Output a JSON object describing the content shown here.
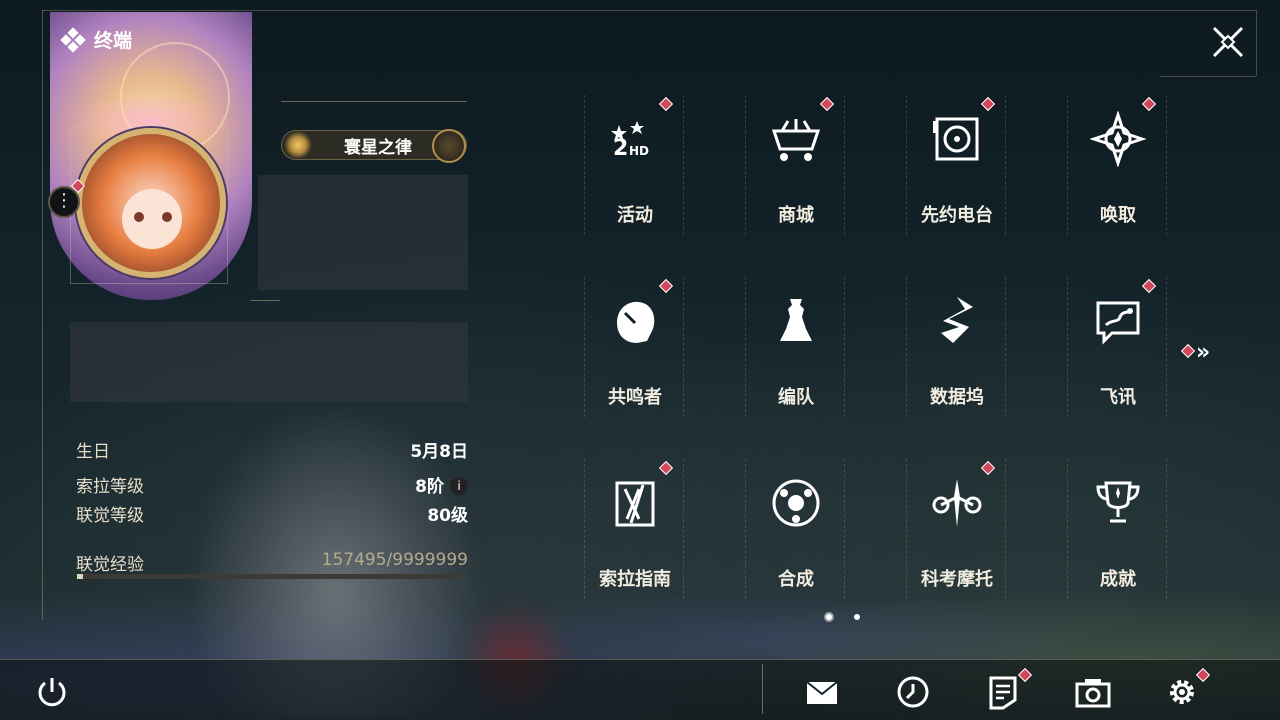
{
  "window": {
    "title": "终端"
  },
  "profile": {
    "name": "寰星之律"
  },
  "stats": [
    {
      "label": "生日",
      "value": "5月8日"
    },
    {
      "label": "索拉等级",
      "value": "8阶"
    },
    {
      "label": "联觉等级",
      "value": "80级"
    }
  ],
  "experience": {
    "label": "联觉经验",
    "value": "157495/9999999",
    "progress_fraction": 0.016
  },
  "menu": [
    {
      "label": "活动",
      "icon": "events-icon",
      "badge": true
    },
    {
      "label": "商城",
      "icon": "shop-cart-icon",
      "badge": true
    },
    {
      "label": "先约电台",
      "icon": "radio-icon",
      "badge": true
    },
    {
      "label": "唤取",
      "icon": "convene-icon",
      "badge": true
    },
    {
      "label": "共鸣者",
      "icon": "resonator-icon",
      "badge": true
    },
    {
      "label": "编队",
      "icon": "team-icon",
      "badge": false
    },
    {
      "label": "数据坞",
      "icon": "data-bank-icon",
      "badge": false
    },
    {
      "label": "飞讯",
      "icon": "messages-icon",
      "badge": true
    },
    {
      "label": "索拉指南",
      "icon": "guidebook-icon",
      "badge": true
    },
    {
      "label": "合成",
      "icon": "synthesis-icon",
      "badge": false
    },
    {
      "label": "科考摩托",
      "icon": "motorbike-icon",
      "badge": true
    },
    {
      "label": "成就",
      "icon": "trophy-icon",
      "badge": false
    }
  ],
  "pagination": {
    "current": 1,
    "total": 2
  },
  "bottom_bar": [
    "power-icon",
    "mail-icon",
    "clock-icon",
    "notice-icon",
    "camera-icon",
    "settings-icon"
  ],
  "colors": {
    "badge": "#d2475a",
    "accent": "#d5b472",
    "text": "#f2ede0"
  }
}
